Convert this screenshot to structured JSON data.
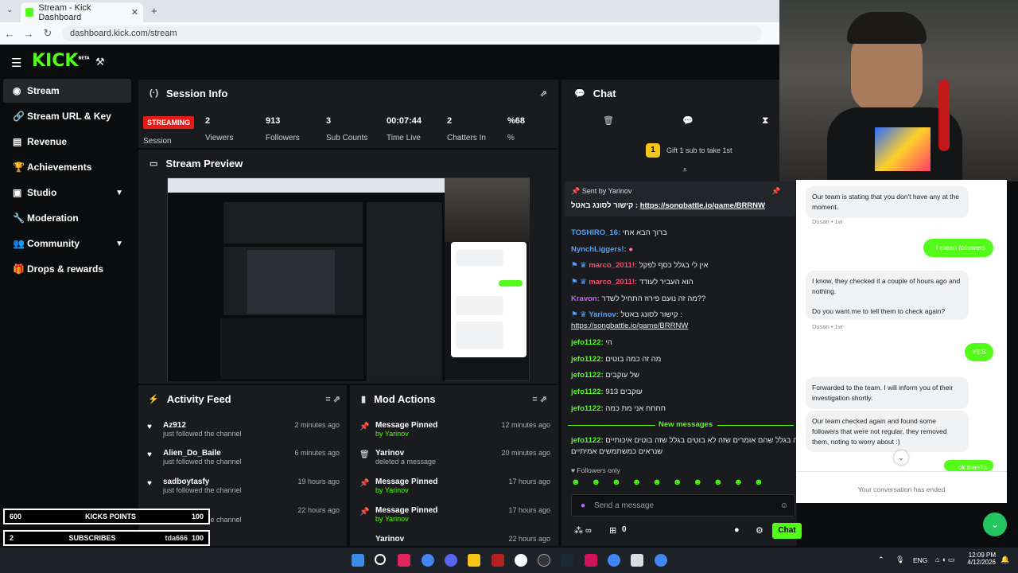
{
  "browser": {
    "tab_title": "Stream - Kick Dashboard",
    "tab_close": "✕",
    "new_tab": "+",
    "url": "dashboard.kick.com/stream"
  },
  "header": {
    "logo": "KICK",
    "logo_badge": "BETA"
  },
  "sidebar": {
    "items": [
      {
        "label": "Stream",
        "icon": "broadcast-icon"
      },
      {
        "label": "Stream URL & Key",
        "icon": "link-icon"
      },
      {
        "label": "Revenue",
        "icon": "chart-icon"
      },
      {
        "label": "Achievements",
        "icon": "trophy-icon"
      },
      {
        "label": "Studio",
        "icon": "studio-icon"
      },
      {
        "label": "Moderation",
        "icon": "wrench-icon"
      },
      {
        "label": "Community",
        "icon": "people-icon"
      },
      {
        "label": "Drops & rewards",
        "icon": "gift-icon"
      }
    ]
  },
  "session": {
    "title": "Session Info",
    "status": "STREAMING",
    "status_label": "Session",
    "stats": [
      {
        "value": "2",
        "label": "Viewers"
      },
      {
        "value": "913",
        "label": "Followers"
      },
      {
        "value": "3",
        "label": "Sub Counts"
      },
      {
        "value": "00:07:44",
        "label": "Time Live"
      },
      {
        "value": "2",
        "label": "Chatters In"
      },
      {
        "value": "%68",
        "label": "%"
      }
    ]
  },
  "preview": {
    "title": "Stream Preview"
  },
  "activity": {
    "title": "Activity Feed",
    "items": [
      {
        "name": "Az912",
        "action": "just followed the channel",
        "time": "2 minutes ago"
      },
      {
        "name": "Alien_Do_Baile",
        "action": "just followed the channel",
        "time": "6 minutes ago"
      },
      {
        "name": "sadboytasfy",
        "action": "just followed the channel",
        "time": "19 hours ago"
      },
      {
        "name": "",
        "action": "just followed the channel",
        "time": "22 hours ago"
      }
    ]
  },
  "mod": {
    "title": "Mod Actions",
    "items": [
      {
        "name": "Message Pinned",
        "by": "by Yarinov",
        "time": "12 minutes ago"
      },
      {
        "name": "Yarinov",
        "by": "deleted a message",
        "time": "20 minutes ago"
      },
      {
        "name": "Message Pinned",
        "by": "by Yarinov",
        "time": "17 hours ago"
      },
      {
        "name": "Message Pinned",
        "by": "by Yarinov",
        "time": "17 hours ago"
      },
      {
        "name": "Yarinov",
        "by": "",
        "time": "22 hours ago"
      }
    ]
  },
  "overlay": {
    "kicks_value": "600",
    "kicks_label": "KICKS POINTS",
    "kicks_goal": "100",
    "subs_value": "2",
    "subs_label": "SUBSCRIBES",
    "subs_name": "tda666",
    "subs_goal": "100"
  },
  "chat": {
    "title": "Chat",
    "gift_count": "1",
    "gift_text": "Gift 1 sub to take 1st",
    "pinned_by": "Sent by",
    "pinned_user": "Yarinov",
    "pinned_text": "קישור לסונג באטל :",
    "pinned_link": "https://songbattle.io/game/BRRNW",
    "messages": [
      {
        "user": "TOSHIRO_16:",
        "text": "ברוך הבא אחי",
        "color": "bl"
      },
      {
        "user": "NynchLiggers!:",
        "text": "",
        "color": "bl"
      },
      {
        "user": "marco_2011!:",
        "text": "אין לי בגלל כסף לפקל",
        "color": "pk"
      },
      {
        "user": "marco_2011!:",
        "text": "הוא העביר לעודד",
        "color": "pk"
      },
      {
        "user": "Kravon:",
        "text": "מה זה נועם פירוז התחיל לשדר??",
        "color": "pk"
      },
      {
        "user": "Yarinov:",
        "text": "קישור לסונג באטל :",
        "color": "bl"
      },
      {
        "user": "",
        "text": "https://songbattle.io/game/BRRNW",
        "color": "link"
      },
      {
        "user": "jefo1122:",
        "text": "הי",
        "color": "gr"
      },
      {
        "user": "jefo1122:",
        "text": "מה זה כמה בוטים",
        "color": "gr"
      },
      {
        "user": "jefo1122:",
        "text": "של עוקבים",
        "color": "gr"
      },
      {
        "user": "jefo1122:",
        "text": "913 עוקבים",
        "color": "gr"
      },
      {
        "user": "jefo1122:",
        "text": "חחחח אני מת כמה",
        "color": "gr"
      }
    ],
    "new_messages": "New messages",
    "last_user": "jefo1122:",
    "last_text": "כנראה בגלל שהם אומרים שזה לא בוטים בגלל שזה בוטים איכותיים",
    "last_text2": "שנראים כמשתמשים אמיתיים",
    "followers_only": "Followers only",
    "placeholder": "Send a message",
    "counter": "0",
    "send": "Chat"
  },
  "support": {
    "msg1": "Our team is stating that you don't have any at the moment.",
    "meta1": "Dusan • 1w",
    "me1": "I mean followers",
    "msg2": "I know, they checked it a couple of hours ago and nothing.",
    "msg2b": "Do you want me to tell them to check again?",
    "meta2": "Dusan • 1w",
    "me2": "YES",
    "msg3": "Forwarded to the team. I will inform you of their investigation shortly.",
    "msg4": "Our team checked again and found some followers that were not regular, they removed them, noting to worry about :)",
    "me3": "ok thanks",
    "ended": "Your conversation has ended"
  },
  "taskbar": {
    "lang": "ENG",
    "time": "12:09 PM",
    "date": "4/12/2026"
  },
  "colors": {
    "brand": "#53fc18",
    "live": "#e91916",
    "panel": "#191b1f"
  }
}
